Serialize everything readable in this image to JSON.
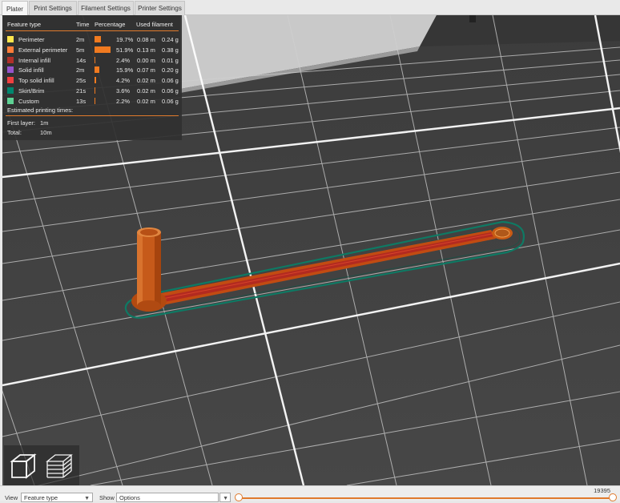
{
  "tabs": [
    {
      "label": "Plater",
      "active": true
    },
    {
      "label": "Print Settings",
      "active": false
    },
    {
      "label": "Filament Settings",
      "active": false
    },
    {
      "label": "Printer Settings",
      "active": false
    }
  ],
  "legend": {
    "headers": {
      "feature": "Feature type",
      "time": "Time",
      "percentage": "Percentage",
      "filament": "Used filament"
    },
    "rows": [
      {
        "name": "Perimeter",
        "color": "#FFE64D",
        "time": "2m",
        "percent": "19.7%",
        "percent_value": 19.7,
        "length": "0.08 m",
        "weight": "0.24 g"
      },
      {
        "name": "External perimeter",
        "color": "#FF7D38",
        "time": "5m",
        "percent": "51.9%",
        "percent_value": 51.9,
        "length": "0.13 m",
        "weight": "0.38 g"
      },
      {
        "name": "Internal infill",
        "color": "#B03029",
        "time": "14s",
        "percent": "2.4%",
        "percent_value": 2.4,
        "length": "0.00 m",
        "weight": "0.01 g"
      },
      {
        "name": "Solid infill",
        "color": "#9654CC",
        "time": "2m",
        "percent": "15.9%",
        "percent_value": 15.9,
        "length": "0.07 m",
        "weight": "0.20 g"
      },
      {
        "name": "Top solid infill",
        "color": "#F04040",
        "time": "25s",
        "percent": "4.2%",
        "percent_value": 4.2,
        "length": "0.02 m",
        "weight": "0.06 g"
      },
      {
        "name": "Skirt/Brim",
        "color": "#00876E",
        "time": "21s",
        "percent": "3.6%",
        "percent_value": 3.6,
        "length": "0.02 m",
        "weight": "0.06 g"
      },
      {
        "name": "Custom",
        "color": "#5ED194",
        "time": "13s",
        "percent": "2.2%",
        "percent_value": 2.2,
        "length": "0.02 m",
        "weight": "0.06 g"
      }
    ],
    "estimated_title": "Estimated printing times:",
    "first_layer_label": "First layer:",
    "first_layer_value": "1m",
    "total_label": "Total:",
    "total_value": "10m"
  },
  "bottom": {
    "view_label": "View",
    "view_value": "Feature type",
    "show_label": "Show",
    "show_value": "Options",
    "layer_count": "19395"
  },
  "icons": {
    "view_iso": "iso-cube-icon",
    "view_layers": "layers-icon"
  }
}
